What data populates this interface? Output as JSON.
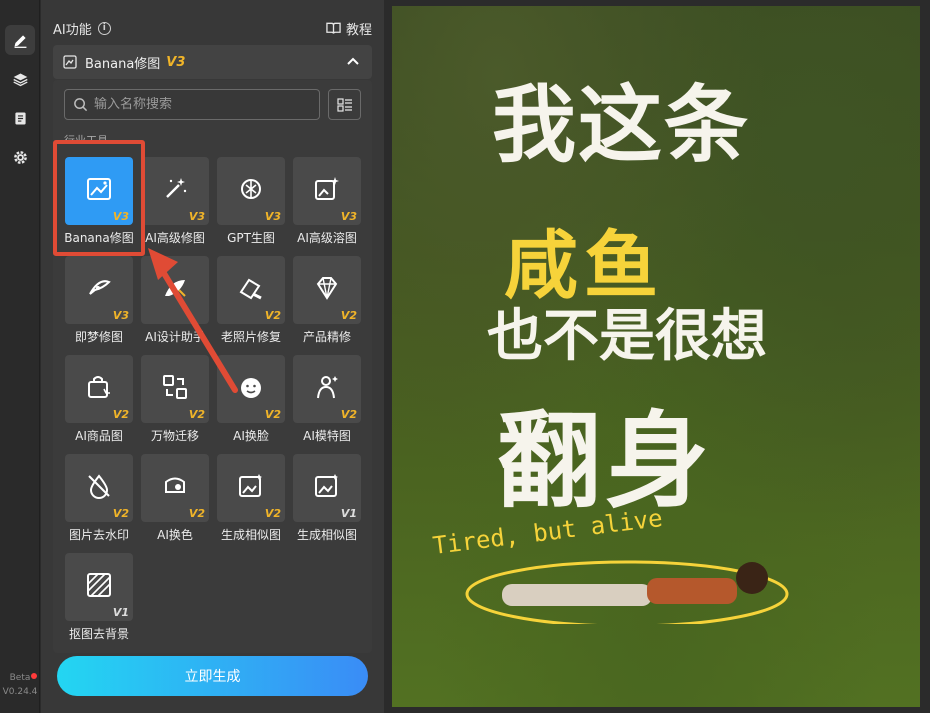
{
  "sidebar": {
    "icons": [
      "edit-icon",
      "layers-icon",
      "document-icon",
      "settings-icon"
    ],
    "badge": "Beta",
    "version": "V0.24.4"
  },
  "panel": {
    "title": "AI功能",
    "tutorial_label": "教程",
    "accordion": {
      "title": "Banana修图",
      "version": "V3"
    },
    "search_placeholder": "输入名称搜索",
    "section_label": "行业工具",
    "tools": [
      {
        "label": "Banana修图",
        "version": "V3",
        "icon": "image-edit-icon",
        "selected": true
      },
      {
        "label": "AI高级修图",
        "version": "V3",
        "icon": "magic-wand-icon"
      },
      {
        "label": "GPT生图",
        "version": "V3",
        "icon": "gpt-icon"
      },
      {
        "label": "AI高级溶图",
        "version": "V3",
        "icon": "image-sparkle-icon"
      },
      {
        "label": "即梦修图",
        "version": "V3",
        "icon": "jimeng-icon"
      },
      {
        "label": "AI设计助手",
        "version": "",
        "icon": "design-helper-icon"
      },
      {
        "label": "老照片修复",
        "version": "V2",
        "icon": "photo-repair-icon"
      },
      {
        "label": "产品精修",
        "version": "V2",
        "icon": "diamond-icon"
      },
      {
        "label": "AI商品图",
        "version": "V2",
        "icon": "shopping-bag-icon"
      },
      {
        "label": "万物迁移",
        "version": "V2",
        "icon": "transfer-icon"
      },
      {
        "label": "AI换脸",
        "version": "V2",
        "icon": "face-swap-icon"
      },
      {
        "label": "AI模特图",
        "version": "V2",
        "icon": "model-icon"
      },
      {
        "label": "图片去水印",
        "version": "V2",
        "icon": "remove-watermark-icon"
      },
      {
        "label": "AI换色",
        "version": "V2",
        "icon": "recolor-icon"
      },
      {
        "label": "生成相似图",
        "version": "V2",
        "icon": "similar-image-icon"
      },
      {
        "label": "生成相似图",
        "version": "V1",
        "icon": "similar-image-icon"
      },
      {
        "label": "抠图去背景",
        "version": "V1",
        "icon": "cutout-icon"
      }
    ],
    "generate_label": "立即生成"
  },
  "poster": {
    "line1": "我这条",
    "line2": "咸鱼",
    "line3": "也不是很想",
    "line4": "翻身",
    "tagline": "Tired, but alive"
  },
  "colors": {
    "accent": "#2f9bf4",
    "version_badge": "#f0b429",
    "highlight": "#e04b35",
    "generate_gradient_start": "#23d6f2",
    "generate_gradient_end": "#3a8cf6"
  }
}
